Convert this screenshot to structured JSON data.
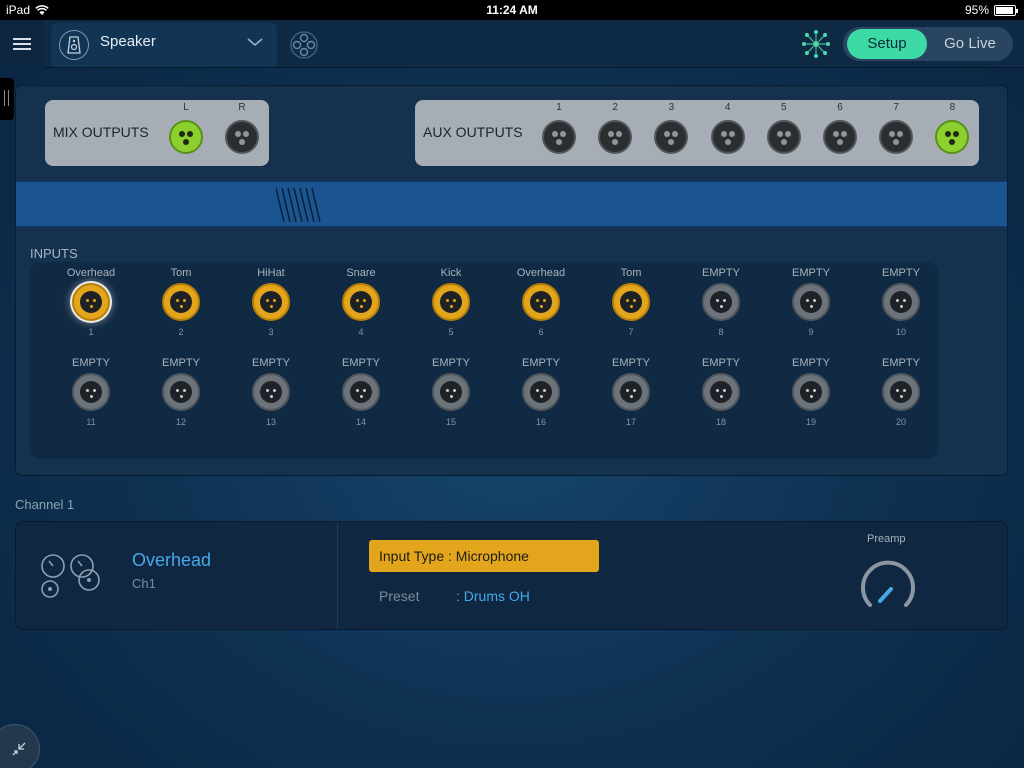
{
  "status_bar": {
    "device": "iPad",
    "time": "11:24 AM",
    "battery": "95%",
    "battery_level": 0.95
  },
  "topbar": {
    "device_name": "Speaker",
    "mode": {
      "setup": "Setup",
      "golive": "Go Live",
      "active": "Setup"
    }
  },
  "mix_outputs": {
    "label": "MIX OUTPUTS",
    "connectors": [
      {
        "label": "L",
        "active": true
      },
      {
        "label": "R",
        "active": false
      }
    ]
  },
  "aux_outputs": {
    "label": "AUX OUTPUTS",
    "connectors": [
      {
        "label": "1",
        "active": false
      },
      {
        "label": "2",
        "active": false
      },
      {
        "label": "3",
        "active": false
      },
      {
        "label": "4",
        "active": false
      },
      {
        "label": "5",
        "active": false
      },
      {
        "label": "6",
        "active": false
      },
      {
        "label": "7",
        "active": false
      },
      {
        "label": "8",
        "active": true
      }
    ]
  },
  "inputs": {
    "label": "INPUTS",
    "items": [
      {
        "name": "Overhead",
        "num": "1",
        "state": "selected"
      },
      {
        "name": "Tom",
        "num": "2",
        "state": "used"
      },
      {
        "name": "HiHat",
        "num": "3",
        "state": "used"
      },
      {
        "name": "Snare",
        "num": "4",
        "state": "used"
      },
      {
        "name": "Kick",
        "num": "5",
        "state": "used"
      },
      {
        "name": "Overhead",
        "num": "6",
        "state": "used"
      },
      {
        "name": "Tom",
        "num": "7",
        "state": "used"
      },
      {
        "name": "EMPTY",
        "num": "8",
        "state": "empty"
      },
      {
        "name": "EMPTY",
        "num": "9",
        "state": "empty"
      },
      {
        "name": "EMPTY",
        "num": "10",
        "state": "empty"
      },
      {
        "name": "EMPTY",
        "num": "11",
        "state": "empty"
      },
      {
        "name": "EMPTY",
        "num": "12",
        "state": "empty"
      },
      {
        "name": "EMPTY",
        "num": "13",
        "state": "empty"
      },
      {
        "name": "EMPTY",
        "num": "14",
        "state": "empty"
      },
      {
        "name": "EMPTY",
        "num": "15",
        "state": "empty"
      },
      {
        "name": "EMPTY",
        "num": "16",
        "state": "empty"
      },
      {
        "name": "EMPTY",
        "num": "17",
        "state": "empty"
      },
      {
        "name": "EMPTY",
        "num": "18",
        "state": "empty"
      },
      {
        "name": "EMPTY",
        "num": "19",
        "state": "empty"
      },
      {
        "name": "EMPTY",
        "num": "20",
        "state": "empty"
      }
    ]
  },
  "channel": {
    "heading": "Channel 1",
    "name": "Overhead",
    "short": "Ch1",
    "input_type": "Input Type :  Microphone",
    "preset_label": "Preset",
    "preset_value": ": Drums OH",
    "preamp_label": "Preamp"
  },
  "colors": {
    "accent_green": "#3ddaa6",
    "used_input": "#e3a51c",
    "active_output": "#8cd030",
    "link_blue": "#47a9e8"
  },
  "icons": {
    "menu": "hamburger-menu-icon",
    "device": "speaker-icon",
    "chevron": "chevron-down-icon",
    "link": "cluster-link-icon",
    "network": "network-icon",
    "knobs": "knobs-icon",
    "collapse": "collapse-arrows-icon"
  }
}
